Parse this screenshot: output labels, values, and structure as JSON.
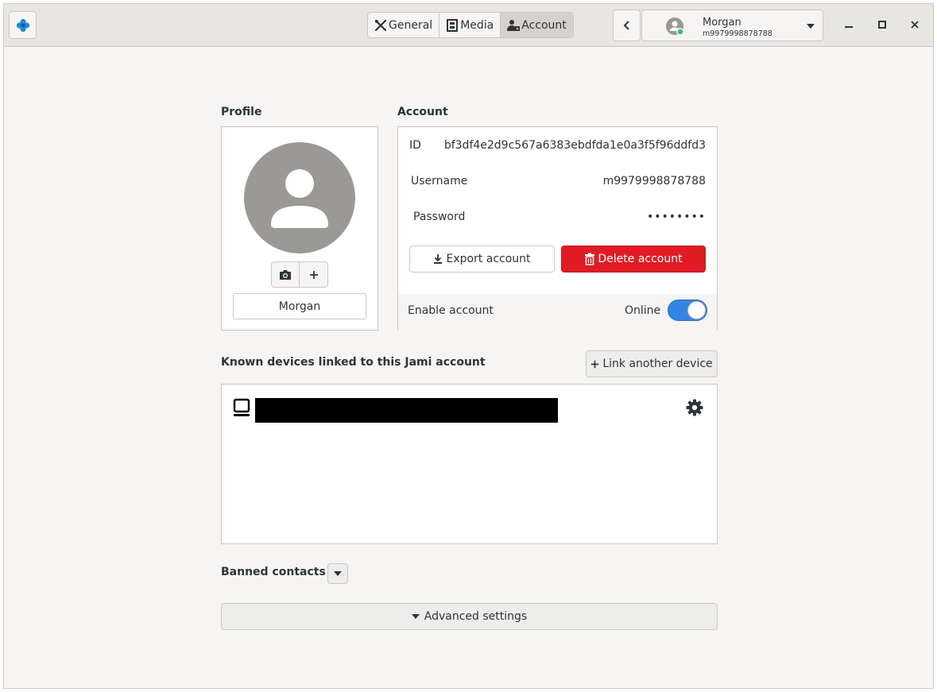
{
  "header": {
    "tabs": [
      {
        "label": "General",
        "icon": "tools-icon"
      },
      {
        "label": "Media",
        "icon": "film-icon"
      },
      {
        "label": "Account",
        "icon": "account-icon",
        "active": true
      }
    ],
    "account_selector": {
      "name": "Morgan",
      "username": "m9979998878788",
      "status_color": "#2ec27e"
    }
  },
  "profile": {
    "title": "Profile",
    "display_name": "Morgan"
  },
  "account": {
    "title": "Account",
    "id_label": "ID",
    "id_value": "bf3df4e2d9c567a6383ebdfda1e0a3f5f96ddfd3",
    "username_label": "Username",
    "username_value": "m9979998878788",
    "password_label": "Password",
    "password_value": "••••••••",
    "export_label": "Export account",
    "delete_label": "Delete account",
    "enable_label": "Enable account",
    "status_text": "Online",
    "enabled": true
  },
  "devices": {
    "title": "Known devices linked to this Jami account",
    "link_label": "Link another device"
  },
  "banned": {
    "title": "Banned contacts"
  },
  "advanced": {
    "label": "Advanced settings"
  },
  "colors": {
    "accent": "#3584e4",
    "danger": "#e01b24",
    "app_icon": "#1f8ad6"
  }
}
